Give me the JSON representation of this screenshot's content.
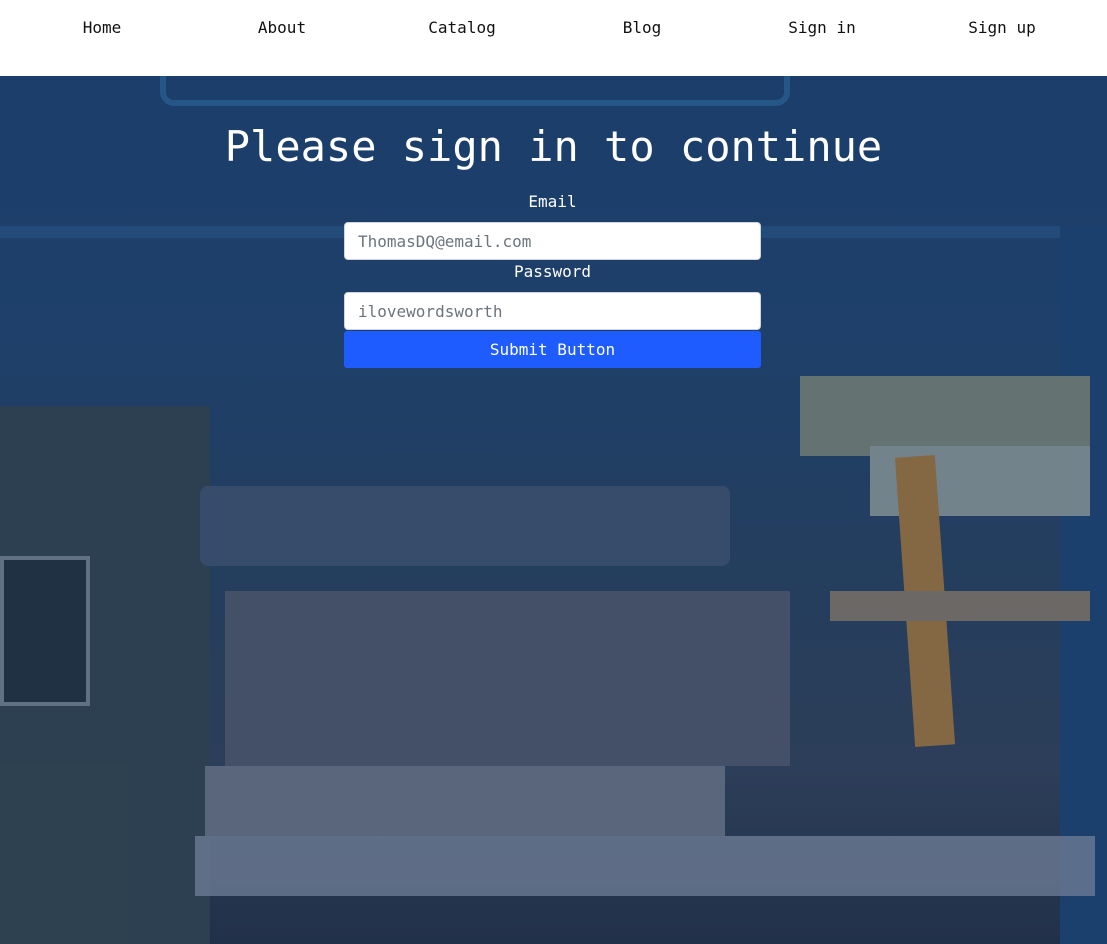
{
  "nav": {
    "items": [
      {
        "label": "Home"
      },
      {
        "label": "About"
      },
      {
        "label": "Catalog"
      },
      {
        "label": "Blog"
      },
      {
        "label": "Sign in"
      },
      {
        "label": "Sign up"
      }
    ]
  },
  "form": {
    "title": "Please sign in to continue",
    "email_label": "Email",
    "email_placeholder": "ThomasDQ@email.com",
    "password_label": "Password",
    "password_placeholder": "ilovewordsworth",
    "submit_label": "Submit Button"
  },
  "colors": {
    "accent": "#1f5cff",
    "navbar": "#ffffff",
    "text_on_bg": "#ffffff"
  }
}
